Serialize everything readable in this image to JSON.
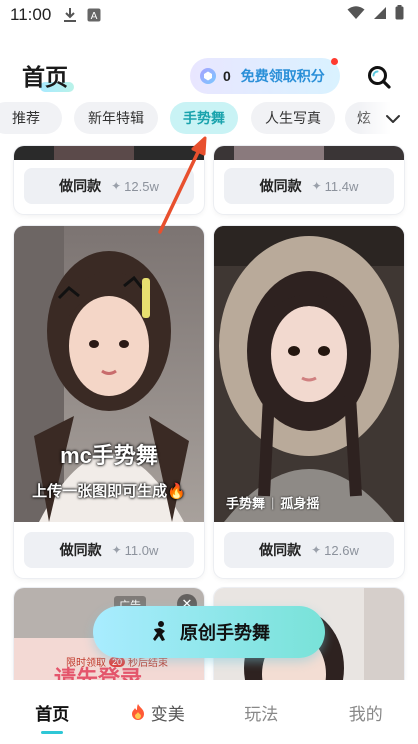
{
  "status_bar": {
    "time": "11:00",
    "icons": [
      "download-icon",
      "a-box-icon",
      "wifi-icon",
      "signal-icon",
      "battery-icon"
    ]
  },
  "header": {
    "title": "首页",
    "points": {
      "count": "0",
      "label": "免费领取积分",
      "has_notification": true
    },
    "search_icon": "search-icon"
  },
  "tabs": {
    "items": [
      {
        "label": "推荐"
      },
      {
        "label": "新年特辑"
      },
      {
        "label": "手势舞",
        "active": true
      },
      {
        "label": "人生写真"
      },
      {
        "label": "炫"
      }
    ],
    "expand_icon": "chevron-down-icon"
  },
  "cards": [
    {
      "button": "做同款",
      "count": "12.5w"
    },
    {
      "button": "做同款",
      "count": "11.4w"
    },
    {
      "title": "mc手势舞",
      "subtitle": "上传一张图即可生成🔥",
      "button": "做同款",
      "count": "11.0w"
    },
    {
      "tags": [
        "手势舞",
        "孤身摇"
      ],
      "button": "做同款",
      "count": "12.6w"
    }
  ],
  "ad": {
    "label": "广告",
    "timer_prefix": "限时领取",
    "timer_badge": "20",
    "timer_suffix": "秒后结束",
    "headline": "请先登录"
  },
  "create_button": {
    "label": "原创手势舞"
  },
  "bottom_nav": {
    "items": [
      {
        "label": "首页",
        "active": true
      },
      {
        "label": "变美"
      },
      {
        "label": "玩法"
      },
      {
        "label": "我的"
      }
    ]
  },
  "colors": {
    "accent": "#2ec7d6",
    "active_tab_bg": "#c9f3f5",
    "active_tab_text": "#1aa3ad",
    "points_text": "#2a8fd8",
    "annotation_arrow": "#e8502e"
  }
}
